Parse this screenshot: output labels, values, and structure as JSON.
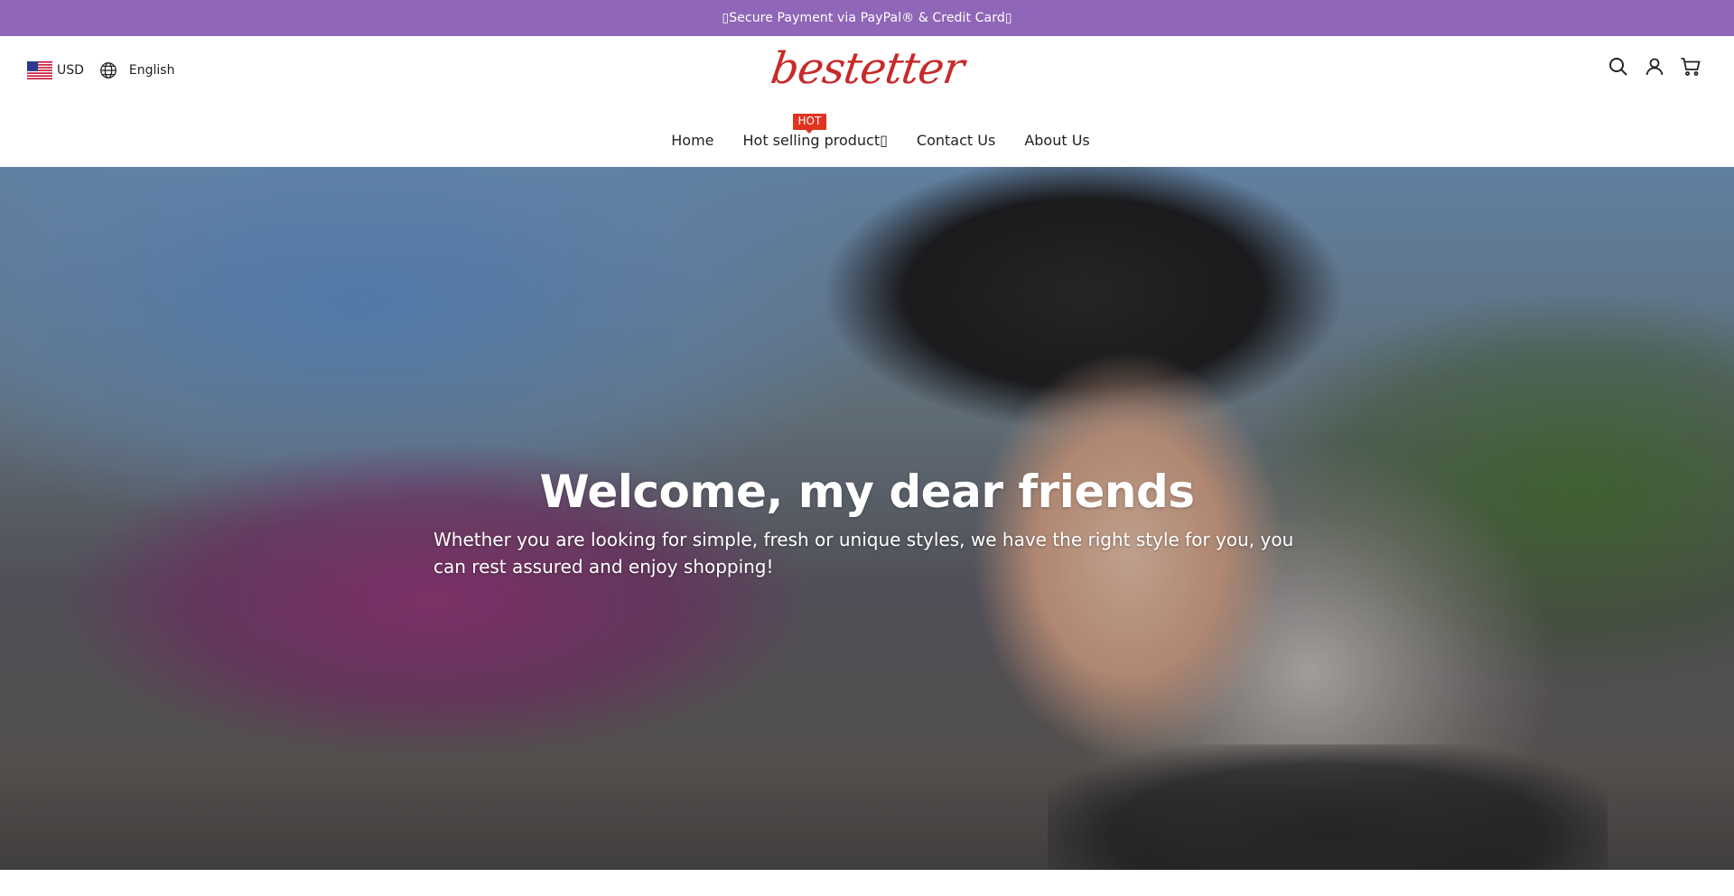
{
  "announcement": {
    "text": "▯Secure Payment via PayPal® & Credit Card▯"
  },
  "header": {
    "currency": {
      "label": "USD",
      "flag": "us-flag-icon"
    },
    "language": {
      "label": "English",
      "icon": "globe-icon"
    },
    "logo": {
      "text": "bestetter",
      "color": "#c82a2a"
    },
    "utility_icons": [
      "search-icon",
      "account-icon",
      "cart-icon"
    ]
  },
  "nav": {
    "items": [
      {
        "label": "Home"
      },
      {
        "label": "Hot selling product▯",
        "badge": "HOT"
      },
      {
        "label": "Contact Us"
      },
      {
        "label": "About Us"
      }
    ]
  },
  "hero": {
    "title": "Welcome, my dear friends",
    "subtitle": "Whether you are looking for simple, fresh or unique styles, we have the right style for you, you can rest assured and enjoy shopping!"
  },
  "colors": {
    "announcement_bg": "#9066b8",
    "badge_bg": "#e0341f",
    "logo": "#c82a2a"
  }
}
